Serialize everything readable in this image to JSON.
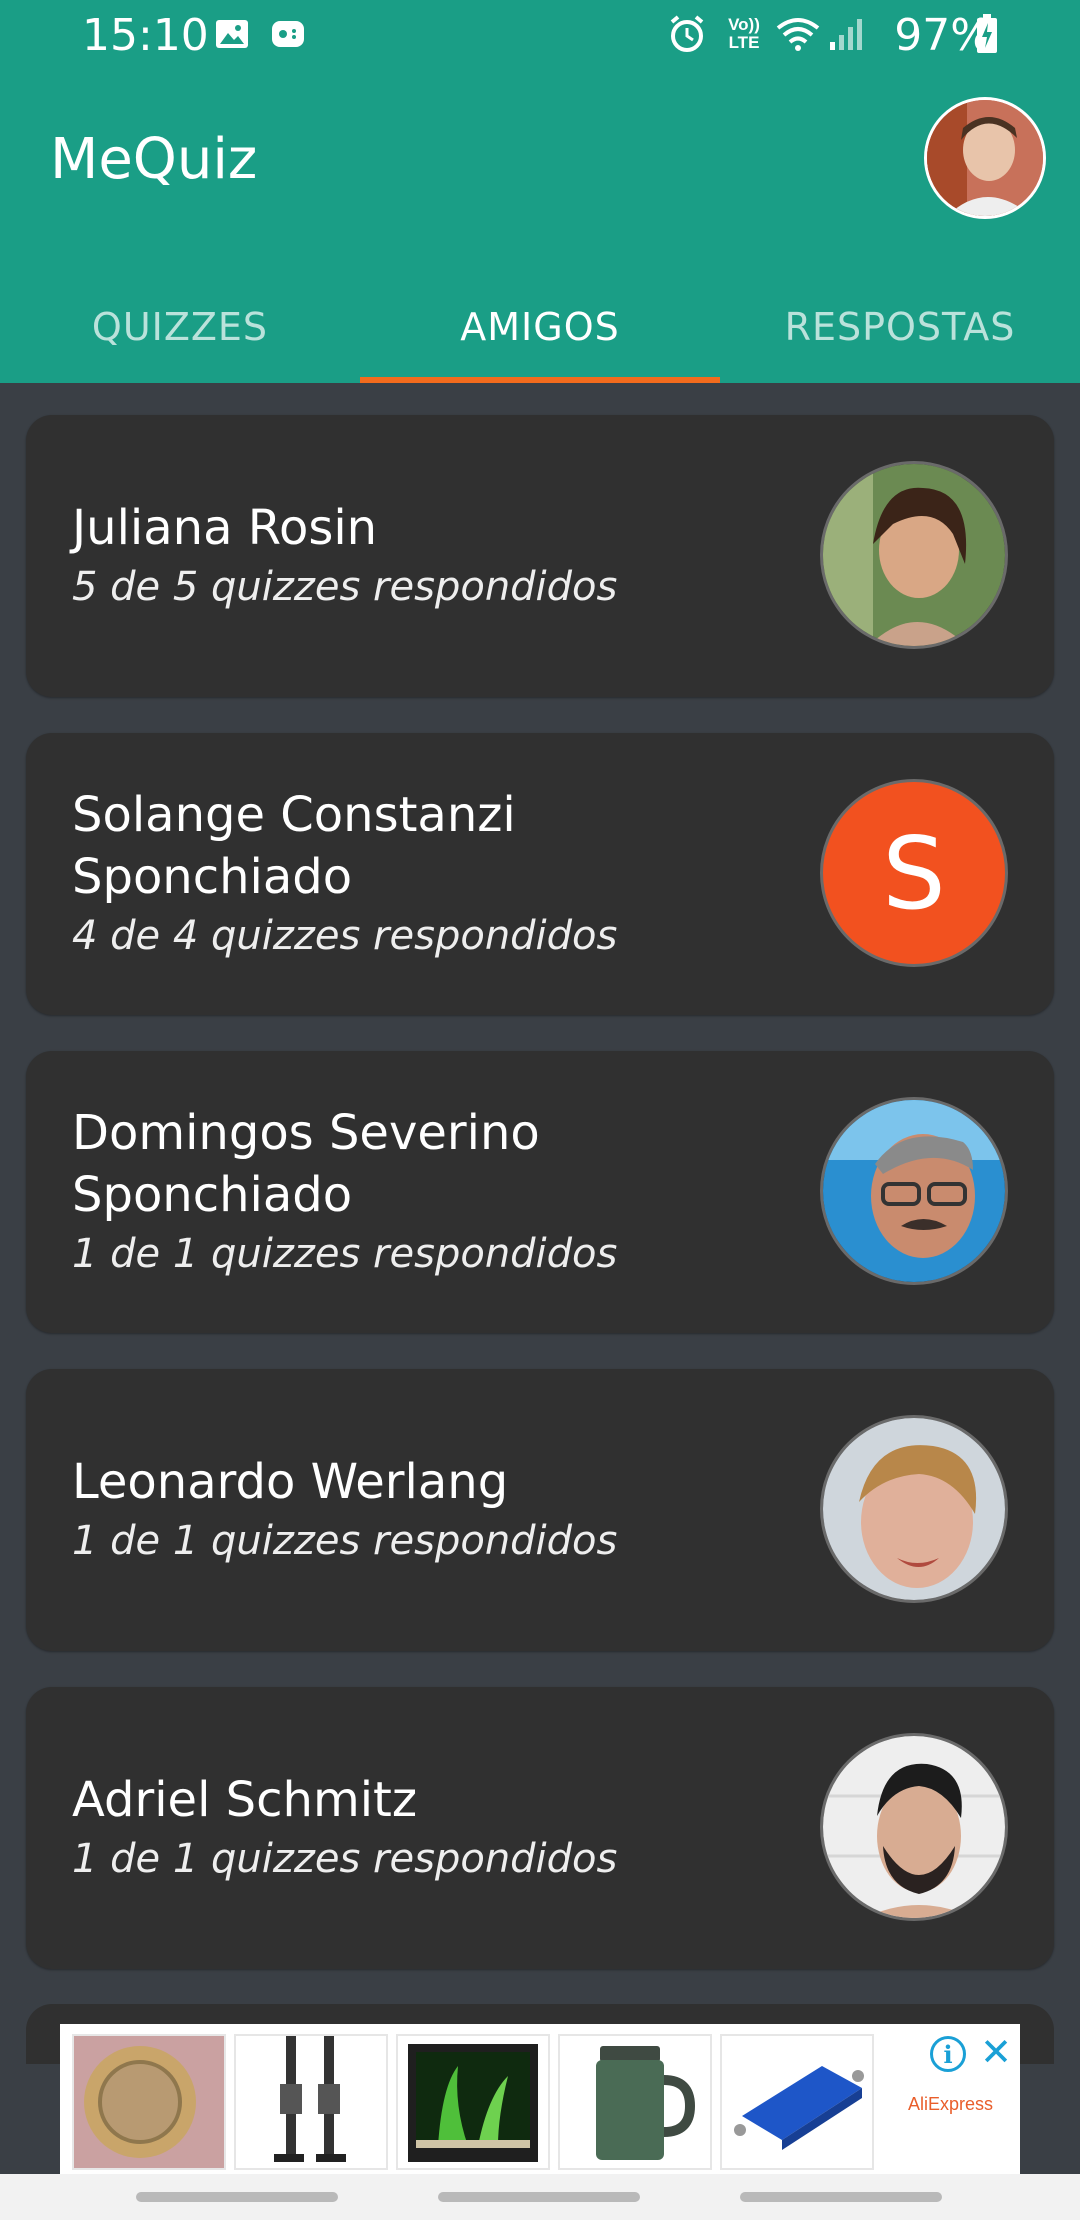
{
  "status_bar": {
    "time": "15:10",
    "volte": "Vo)) LTE",
    "battery": "97%"
  },
  "app": {
    "title": "MeQuiz"
  },
  "tabs": [
    {
      "label": "QUIZZES",
      "active": false
    },
    {
      "label": "AMIGOS",
      "active": true
    },
    {
      "label": "RESPOSTAS",
      "active": false
    }
  ],
  "friends": [
    {
      "name": "Juliana Rosin",
      "subtitle": "5 de 5 quizzes respondidos"
    },
    {
      "name": "Solange Constanzi Sponchiado",
      "subtitle": "4 de 4 quizzes respondidos",
      "initial": "S"
    },
    {
      "name": "Domingos Severino Sponchiado",
      "subtitle": "1 de 1 quizzes respondidos"
    },
    {
      "name": "Leonardo Werlang",
      "subtitle": "1 de 1 quizzes respondidos"
    },
    {
      "name": "Adriel Schmitz",
      "subtitle": "1 de 1 quizzes respondidos"
    }
  ],
  "ad": {
    "brand": "AliExpress",
    "info_label": "i",
    "close_label": "✕"
  },
  "colors": {
    "appbar": "#1a9e86",
    "tab_indicator": "#f26b1d",
    "card": "#303030",
    "background": "#3a3f45",
    "initial_avatar": "#f2511f"
  }
}
